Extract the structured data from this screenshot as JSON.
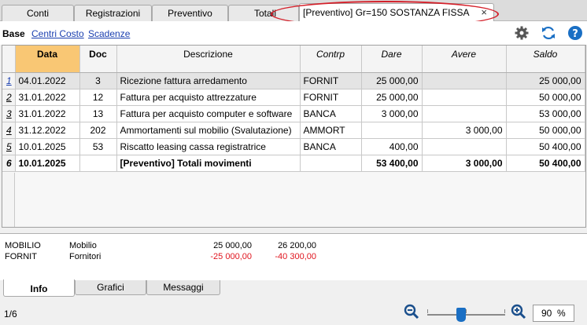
{
  "tabs": [
    {
      "label": "Conti"
    },
    {
      "label": "Registrazioni"
    },
    {
      "label": "Preventivo"
    },
    {
      "label": "Totali"
    },
    {
      "label": "[Preventivo] Gr=150 SOSTANZA FISSA",
      "active": true
    }
  ],
  "toolbar": {
    "base": "Base",
    "links": [
      "Centri Costo",
      "Scadenze"
    ],
    "icons": [
      "gear-icon",
      "refresh-icon",
      "help-icon"
    ]
  },
  "grid": {
    "columns": [
      "Data",
      "Doc",
      "Descrizione",
      "Contrp",
      "Dare",
      "Avere",
      "Saldo"
    ],
    "rows": [
      {
        "n": "1",
        "data": "04.01.2022",
        "doc": "3",
        "desc": "Ricezione fattura arredamento",
        "contrp": "FORNIT",
        "dare": "25 000,00",
        "avere": "",
        "saldo": "25 000,00"
      },
      {
        "n": "2",
        "data": "31.01.2022",
        "doc": "12",
        "desc": "Fattura per acquisto attrezzature",
        "contrp": "FORNIT",
        "dare": "25 000,00",
        "avere": "",
        "saldo": "50 000,00"
      },
      {
        "n": "3",
        "data": "31.01.2022",
        "doc": "13",
        "desc": "Fattura per acquisto computer e software",
        "contrp": "BANCA",
        "dare": "3 000,00",
        "avere": "",
        "saldo": "53 000,00"
      },
      {
        "n": "4",
        "data": "31.12.2022",
        "doc": "202",
        "desc": "Ammortamenti sul mobilio (Svalutazione)",
        "contrp": "AMMORT",
        "dare": "",
        "avere": "3 000,00",
        "saldo": "50 000,00"
      },
      {
        "n": "5",
        "data": "10.01.2025",
        "doc": "53",
        "desc": "Riscatto leasing cassa registratrice",
        "contrp": "BANCA",
        "dare": "400,00",
        "avere": "",
        "saldo": "50 400,00"
      }
    ],
    "total": {
      "n": "6",
      "data": "10.01.2025",
      "doc": "",
      "desc": "[Preventivo] Totali movimenti",
      "contrp": "",
      "dare": "53 400,00",
      "avere": "3 000,00",
      "saldo": "50 400,00"
    }
  },
  "info": {
    "rows": [
      {
        "code": "MOBILIO",
        "name": "Mobilio",
        "v1": "25 000,00",
        "v2": "26 200,00"
      },
      {
        "code": "FORNIT",
        "name": "Fornitori",
        "v1": "-25 000,00",
        "v2": "-40 300,00"
      }
    ]
  },
  "bottom_tabs": [
    "Info",
    "Grafici",
    "Messaggi"
  ],
  "status": {
    "page": "1/6",
    "zoom": "90",
    "zoom_unit": "%"
  },
  "colors": {
    "accent_header": "#f9c774",
    "negative": "#e0141e",
    "highlight_ellipse": "#d4202a",
    "link": "#1a3fb0"
  }
}
